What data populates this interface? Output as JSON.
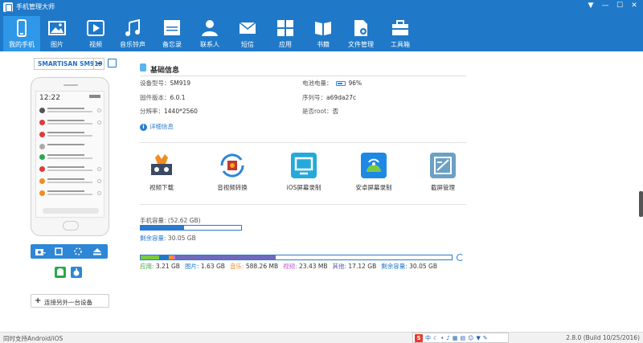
{
  "window": {
    "title": "手机管理大师"
  },
  "toolbar": {
    "items": [
      {
        "label": "我的手机",
        "icon": "phone-icon",
        "active": true
      },
      {
        "label": "图片",
        "icon": "image-icon"
      },
      {
        "label": "视频",
        "icon": "video-icon"
      },
      {
        "label": "音乐铃声",
        "icon": "music-icon"
      },
      {
        "label": "备忘录",
        "icon": "memo-icon"
      },
      {
        "label": "联系人",
        "icon": "contacts-icon"
      },
      {
        "label": "短信",
        "icon": "sms-icon"
      },
      {
        "label": "应用",
        "icon": "apps-icon"
      },
      {
        "label": "书籍",
        "icon": "book-icon"
      },
      {
        "label": "文件管理",
        "icon": "file-manager-icon"
      },
      {
        "label": "工具箱",
        "icon": "toolbox-icon"
      }
    ]
  },
  "device": {
    "selected": "SMARTISAN SM919",
    "screen_time": "12:22",
    "connect_label": "连接另外一台设备"
  },
  "basic_info": {
    "title": "基础信息",
    "model_label": "设备型号：",
    "model": "SM919",
    "firmware_label": "固件版本：",
    "firmware": "6.0.1",
    "resolution_label": "分辨率：",
    "resolution": "1440*2560",
    "battery_label": "电池电量：",
    "battery": "96%",
    "serial_label": "序列号：",
    "serial": "a69da27c",
    "root_label": "是否root：",
    "root": "否",
    "detail_link": "详细信息"
  },
  "features": [
    {
      "label": "视频下载",
      "icon": "video-download-icon"
    },
    {
      "label": "音视频转换",
      "icon": "av-convert-icon"
    },
    {
      "label": "iOS屏幕录制",
      "icon": "ios-screen-record-icon"
    },
    {
      "label": "安卓屏幕录制",
      "icon": "android-screen-record-icon"
    },
    {
      "label": "截屏管理",
      "icon": "screenshot-manager-icon"
    }
  ],
  "phone_capacity": {
    "label": "手机容量: (52.62 GB)",
    "free_key": "剩余容量:",
    "free_value": "30.05 GB",
    "used_fraction": 0.43
  },
  "storage_breakdown": {
    "segments": [
      {
        "key": "应用:",
        "value": "3.21 GB",
        "color": "#7ac943"
      },
      {
        "key": "图片:",
        "value": "1.63 GB",
        "color": "#1f79c8"
      },
      {
        "key": "音乐:",
        "value": "588.26 MB",
        "color": "#f7931e"
      },
      {
        "key": "视频:",
        "value": "23.43 MB",
        "color": "#d66be0"
      },
      {
        "key": "其他:",
        "value": "17.12 GB",
        "color": "#6b6bbf"
      },
      {
        "key": "剩余容量:",
        "value": "30.05 GB",
        "color": "#ffffff"
      }
    ],
    "legend_colors": [
      "#3f9f3f",
      "#1f79c8",
      "#e8871e",
      "#c05ad0",
      "#5a5ab0",
      "#1f79c8"
    ]
  },
  "statusbar": {
    "left": "同时支持Android/iOS",
    "version": "2.8.0 (Build 10/25/2016)",
    "ime_label": "中"
  }
}
